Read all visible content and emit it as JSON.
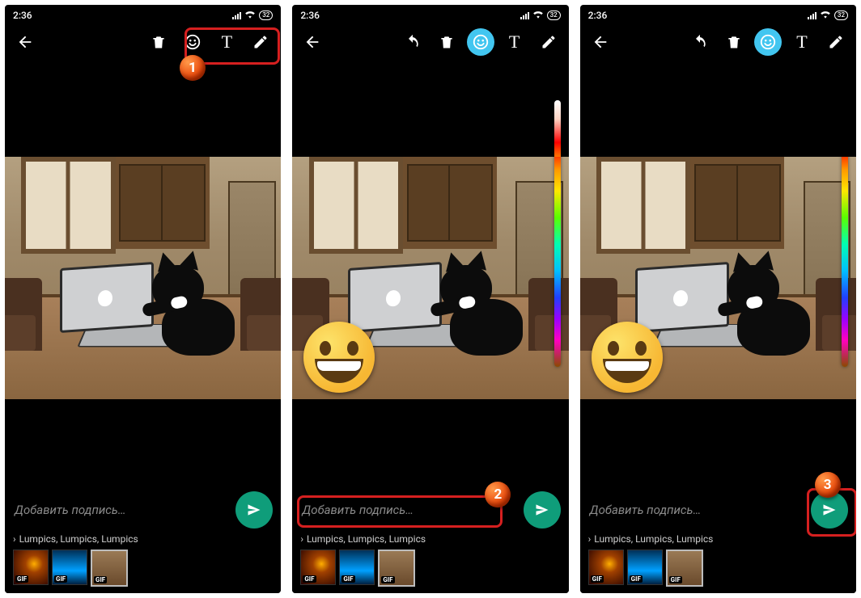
{
  "status": {
    "time": "2:36",
    "battery": "32"
  },
  "toolbar": {
    "back": "←",
    "undo": "↶",
    "trash": "🗑",
    "emoji": "☺",
    "text": "T",
    "draw": "✎"
  },
  "caption": {
    "placeholder": "Добавить подпись…"
  },
  "recipients": {
    "chev": "›",
    "text": "Lumpics, Lumpics, Lumpics"
  },
  "thumbs": {
    "gif_label": "GIF"
  },
  "annotations": {
    "one": "1",
    "two": "2",
    "three": "3"
  },
  "screens": [
    {
      "has_undo": false,
      "emoji_active": false,
      "show_emoji_face": false,
      "show_slider": false
    },
    {
      "has_undo": true,
      "emoji_active": true,
      "show_emoji_face": true,
      "show_slider": true
    },
    {
      "has_undo": true,
      "emoji_active": true,
      "show_emoji_face": true,
      "show_slider": true
    }
  ]
}
